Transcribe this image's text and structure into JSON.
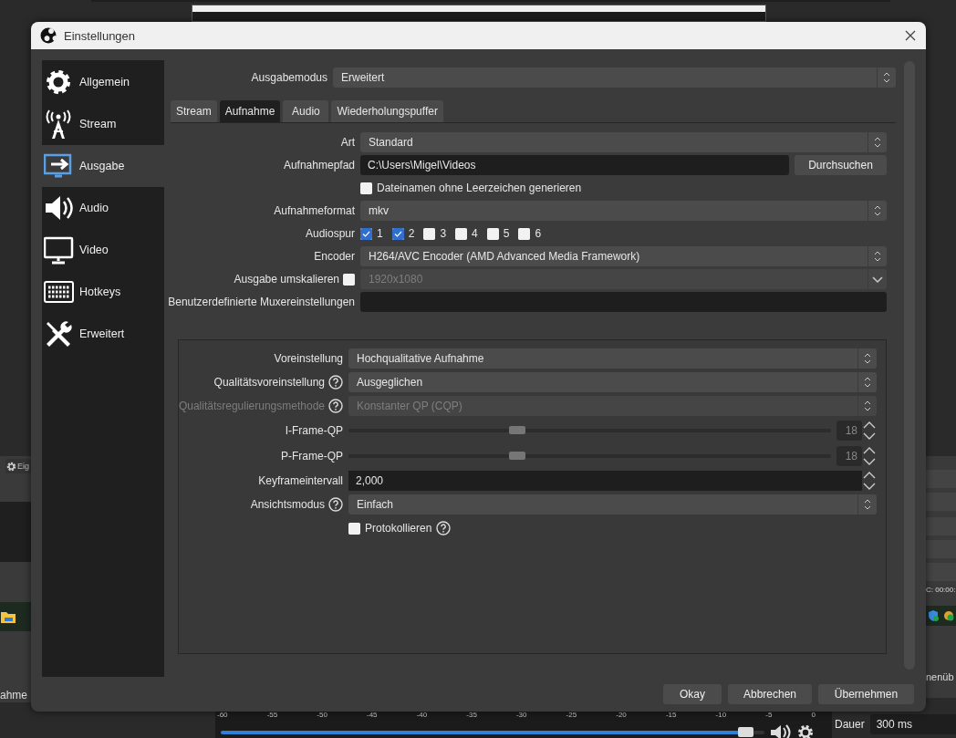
{
  "background": {
    "tool_button": "Eig",
    "left_text": "ahme",
    "timecode": "C: 00:00:",
    "right_text": "nenüb",
    "duration": {
      "label": "Dauer",
      "value": "300 ms"
    },
    "meter": {
      "ticks": [
        "-60",
        "-55",
        "-50",
        "-45",
        "-40",
        "-35",
        "-30",
        "-25",
        "-20",
        "-15",
        "-10",
        "-5",
        "0"
      ],
      "level": 0.98
    }
  },
  "window": {
    "title": "Einstellungen"
  },
  "sidebar": {
    "items": [
      {
        "label": "Allgemein",
        "selected": false
      },
      {
        "label": "Stream",
        "selected": false
      },
      {
        "label": "Ausgabe",
        "selected": true
      },
      {
        "label": "Audio",
        "selected": false
      },
      {
        "label": "Video",
        "selected": false
      },
      {
        "label": "Hotkeys",
        "selected": false
      },
      {
        "label": "Erweitert",
        "selected": false
      }
    ]
  },
  "output_mode": {
    "label": "Ausgabemodus",
    "value": "Erweitert"
  },
  "tabs": [
    {
      "label": "Stream",
      "selected": false
    },
    {
      "label": "Aufnahme",
      "selected": true
    },
    {
      "label": "Audio",
      "selected": false
    },
    {
      "label": "Wiederholungspuffer",
      "selected": false
    }
  ],
  "fields": [
    {
      "kind": "combo",
      "label": "Art",
      "value": "Standard",
      "disabled": false
    },
    {
      "kind": "path",
      "label": "Aufnahmepfad",
      "value": "C:\\Users\\Migel\\Videos",
      "button": "Durchsuchen"
    },
    {
      "kind": "checkbox",
      "label": "Dateinamen ohne Leerzeichen generieren",
      "checked": false
    },
    {
      "kind": "combo",
      "label": "Aufnahmeformat",
      "value": "mkv",
      "disabled": false
    },
    {
      "kind": "tracks",
      "label": "Audiospur",
      "tracks": [
        {
          "label": "1",
          "checked": true
        },
        {
          "label": "2",
          "checked": true
        },
        {
          "label": "3",
          "checked": false
        },
        {
          "label": "4",
          "checked": false
        },
        {
          "label": "5",
          "checked": false
        },
        {
          "label": "6",
          "checked": false
        }
      ]
    },
    {
      "kind": "combo",
      "label": "Encoder",
      "value": "H264/AVC Encoder (AMD Advanced Media Framework)",
      "disabled": false
    },
    {
      "kind": "rescale",
      "label": "Ausgabe umskalieren",
      "checked": false,
      "value": "1920x1080",
      "disabled": true
    },
    {
      "kind": "text",
      "label": "Benutzerdefinierte Muxereinstellungen"
    }
  ],
  "encoder_settings": [
    {
      "kind": "combo",
      "label": "Voreinstellung",
      "help": false,
      "value": "Hochqualitative Aufnahme",
      "disabled": false
    },
    {
      "kind": "combo",
      "label": "Qualitätsvoreinstellung",
      "help": true,
      "value": "Ausgeglichen",
      "disabled": false
    },
    {
      "kind": "combo",
      "label": "Qualitätsregulierungsmethode",
      "help": true,
      "value": "Konstanter QP (CQP)",
      "disabled": true
    },
    {
      "kind": "slider",
      "label": "I-Frame-QP",
      "level": 0.35,
      "value": "18"
    },
    {
      "kind": "slider",
      "label": "P-Frame-QP",
      "level": 0.35,
      "value": "18"
    },
    {
      "kind": "spin",
      "label": "Keyframeintervall",
      "value": "2,000"
    },
    {
      "kind": "combo",
      "label": "Ansichtsmodus",
      "help": true,
      "value": "Einfach",
      "disabled": false
    },
    {
      "kind": "checkbox",
      "label": "Protokollieren",
      "help": true,
      "checked": false
    }
  ],
  "buttons": [
    "Okay",
    "Abbrechen",
    "Übernehmen"
  ]
}
